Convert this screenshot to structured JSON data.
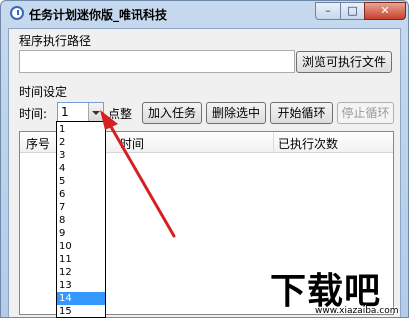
{
  "window": {
    "title": "任务计划迷你版_唯讯科技",
    "minimize_label": "–",
    "maximize_label": "□",
    "close_label": "✕"
  },
  "path_section": {
    "label": "程序执行路径",
    "value": "",
    "browse_button": "浏览可执行文件"
  },
  "time_section": {
    "label": "时间设定",
    "time_label": "时间:",
    "hour_value": "1",
    "unit_label": "点整",
    "add_button": "加入任务",
    "delete_button": "删除选中",
    "start_button": "开始循环",
    "stop_button": "停止循环"
  },
  "table": {
    "columns": [
      "序号",
      "时间",
      "已执行次数"
    ]
  },
  "dropdown": {
    "options": [
      "1",
      "2",
      "3",
      "4",
      "5",
      "6",
      "7",
      "8",
      "9",
      "10",
      "11",
      "12",
      "13",
      "14",
      "15"
    ],
    "selected": "14"
  },
  "watermark": {
    "logo": "下载吧",
    "url": "www.xiazaiba.com"
  }
}
